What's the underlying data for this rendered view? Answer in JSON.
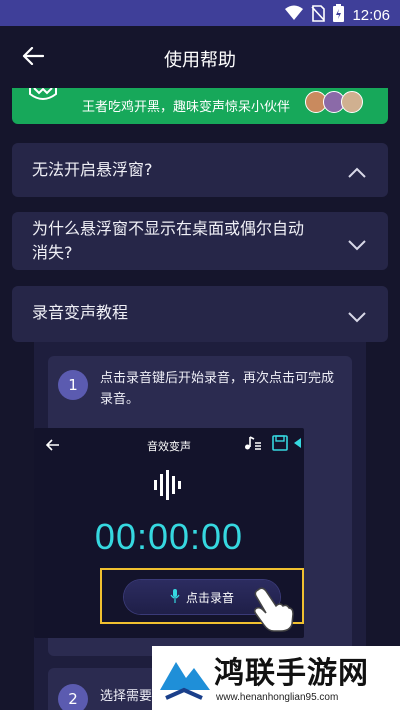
{
  "status_bar": {
    "time": "12:06",
    "icons": [
      "wifi-icon",
      "no-sim-icon",
      "battery-icon"
    ]
  },
  "app_bar": {
    "title": "使用帮助",
    "back_icon": "arrow-left-icon"
  },
  "banner": {
    "text": "王者吃鸡开黑，趣味变声惊呆小伙伴",
    "background": "#17a85a"
  },
  "faq": [
    {
      "question": "无法开启悬浮窗?",
      "expanded": false,
      "chevron": "chevron-up-icon"
    },
    {
      "question_line1": "为什么悬浮窗不显示在桌面或偶尔自动",
      "question_line2": "消失?",
      "expanded": false,
      "chevron": "chevron-down-icon"
    },
    {
      "question": "录音变声教程",
      "expanded": true,
      "chevron": "chevron-down-icon"
    }
  ],
  "tutorial": {
    "steps": [
      {
        "number": "1",
        "text": "点击录音键后开始录音，再次点击可完成录音。"
      },
      {
        "number": "2",
        "text": "选择需要"
      }
    ],
    "screen": {
      "title": "音效变声",
      "timer": "00:00:00",
      "record_button_label": "点击录音",
      "accent": "#36d8e0",
      "highlight": "#f0c030"
    }
  },
  "watermark": {
    "title": "鸿联手游网",
    "url": "www.henanhonglian95.com"
  },
  "colors": {
    "background": "#15152c",
    "card": "#262648",
    "status_bar": "#3f3f99"
  }
}
